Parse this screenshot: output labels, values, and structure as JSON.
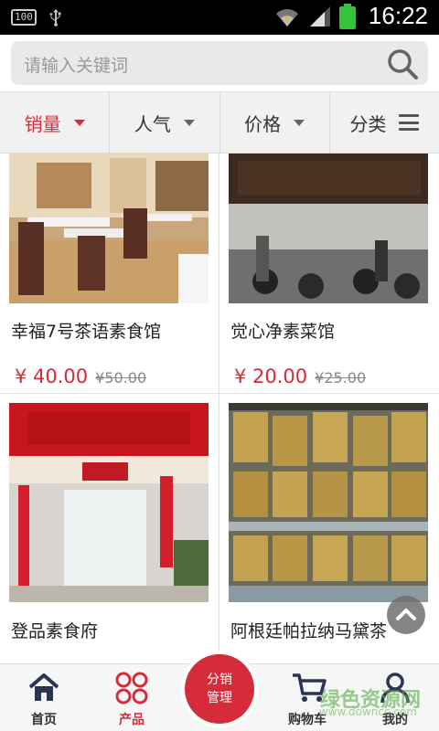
{
  "status_bar": {
    "battery_small": "100",
    "time": "16:22",
    "icons": [
      "battery-100-icon",
      "usb-icon",
      "wifi-icon",
      "signal-icon",
      "battery-icon"
    ],
    "battery_color": "#36c23a"
  },
  "search": {
    "placeholder": "请输入关键词",
    "icon": "search-icon"
  },
  "filters": [
    {
      "label": "销量",
      "icon": "triangle-down-icon",
      "active": true
    },
    {
      "label": "人气",
      "icon": "triangle-down-icon",
      "active": false
    },
    {
      "label": "价格",
      "icon": "triangle-down-icon",
      "active": false
    },
    {
      "label": "分类",
      "icon": "menu-icon",
      "active": false
    }
  ],
  "products": [
    {
      "name": "幸福7号茶语素食馆",
      "price": "¥  40.00",
      "old_price": "¥50.00",
      "image": "restaurant-interior-photo"
    },
    {
      "name": "觉心净素菜馆",
      "price": "¥  20.00",
      "old_price": "¥25.00",
      "image": "shopfront-scooters-photo"
    },
    {
      "name": "登品素食府",
      "price": "",
      "old_price": "",
      "image": "restaurant-entrance-photo"
    },
    {
      "name": "阿根廷帕拉纳马黛茶",
      "price": "",
      "old_price": "",
      "image": "tea-boxes-photo"
    }
  ],
  "nav": [
    {
      "label": "首页",
      "icon": "home-icon",
      "active": false
    },
    {
      "label": "产品",
      "icon": "products-grid-icon",
      "active": true
    },
    {
      "label": "分销\n管理",
      "icon": "",
      "active": false
    },
    {
      "label": "购物车",
      "icon": "cart-icon",
      "active": false
    },
    {
      "label": "我的",
      "icon": "user-icon",
      "active": false
    }
  ],
  "watermark": {
    "main": "绿色资源网",
    "sub": "www.downcc.com"
  },
  "colors": {
    "accent": "#d62b3a",
    "status_bar": "#000000"
  }
}
